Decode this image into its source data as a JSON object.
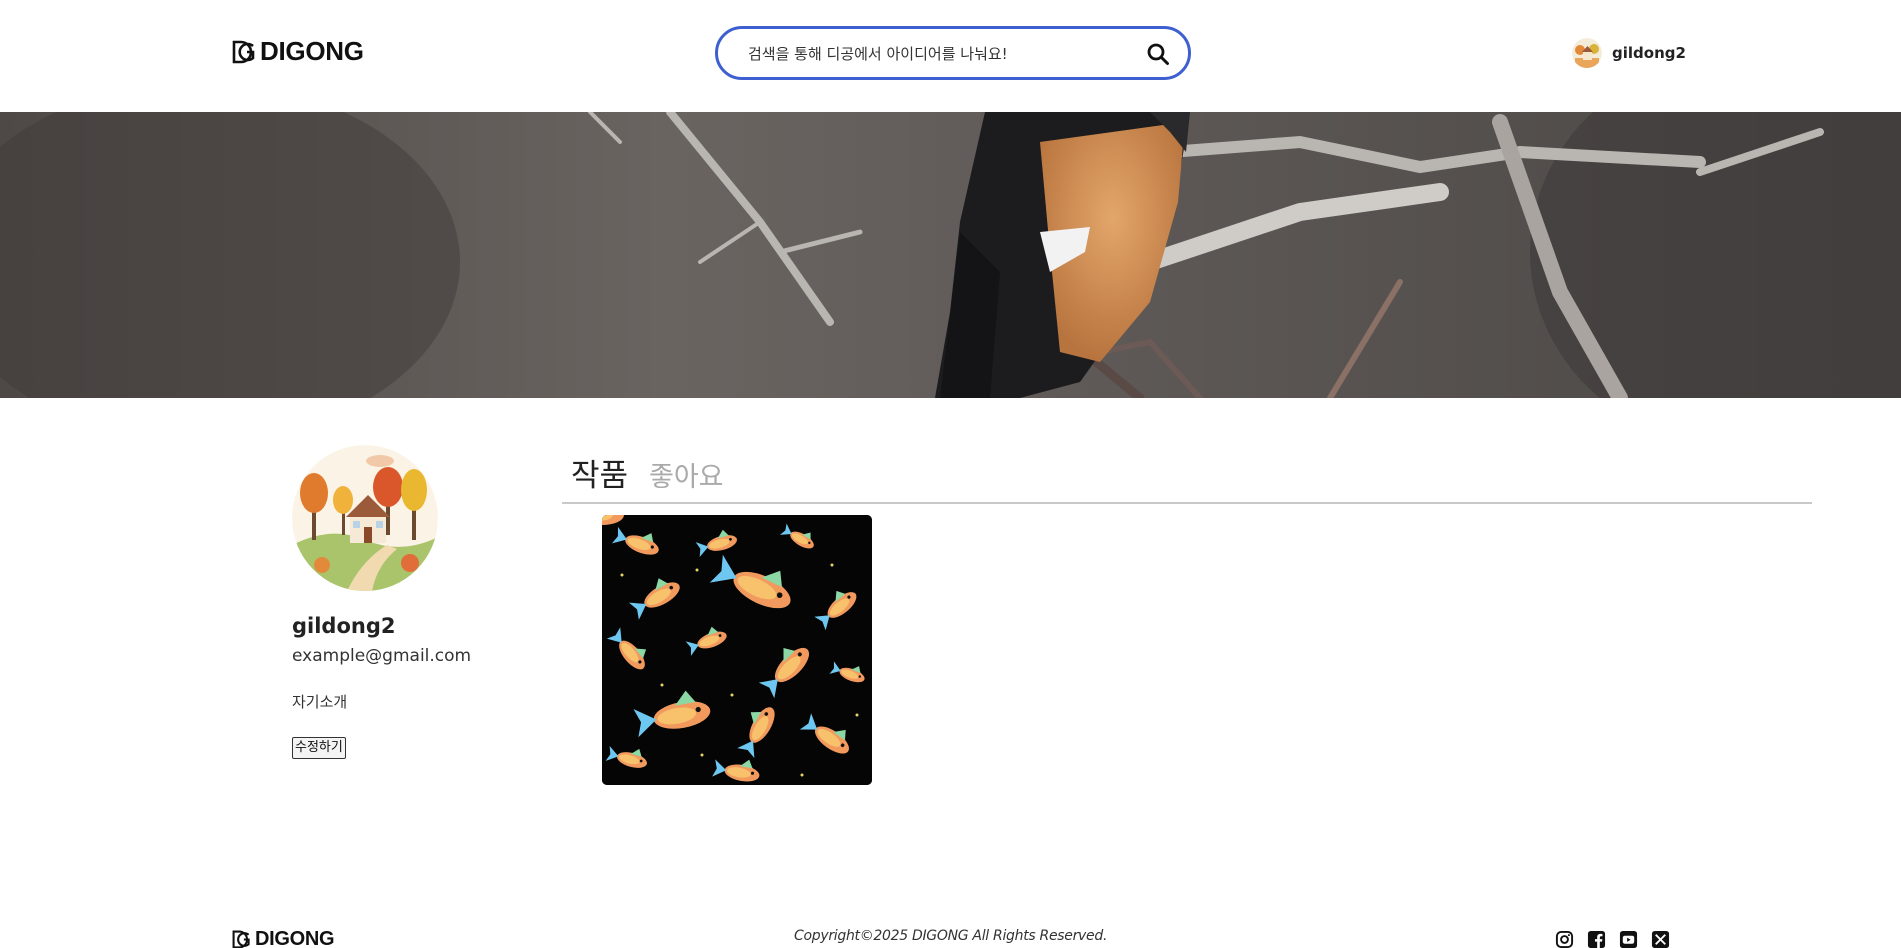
{
  "header": {
    "logo_text": "DIGONG",
    "search": {
      "placeholder": "검색을 통해 디공에서 아이디어를 나눠요!",
      "value": ""
    },
    "user": {
      "name": "gildong2"
    }
  },
  "profile": {
    "name": "gildong2",
    "email": "example@gmail.com",
    "intro": "자기소개",
    "edit_label": "수정하기"
  },
  "tabs": [
    {
      "label": "작품",
      "active": true
    },
    {
      "label": "좋아요",
      "active": false
    }
  ],
  "footer": {
    "logo_text": "DIGONG",
    "copyright": "Copyright©2025 DIGONG All Rights Reserved.",
    "socials": [
      "instagram-icon",
      "facebook-icon",
      "youtube-icon",
      "x-icon"
    ]
  },
  "colors": {
    "accent": "#3e5fd0",
    "tab_active": "#222222",
    "tab_inactive": "#aaaaaa"
  }
}
